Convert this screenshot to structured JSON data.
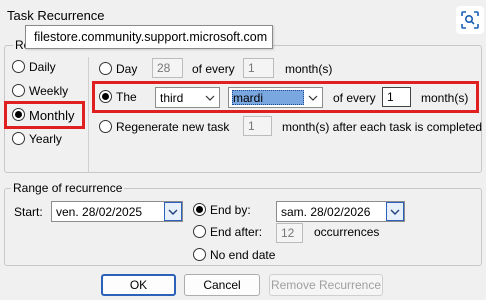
{
  "window": {
    "title": "Task Recurrence"
  },
  "tooltip": {
    "text": "filestore.community.support.microsoft.com"
  },
  "icons": {
    "scan": "scan-text-icon",
    "dropdown": "chevron-down-icon"
  },
  "accent": {
    "highlight_red": "#e02020",
    "focus_blue": "#2b61b8"
  },
  "pattern": {
    "legend": "Rec",
    "frequency": [
      {
        "label": "Daily",
        "checked": false
      },
      {
        "label": "Weekly",
        "checked": false
      },
      {
        "label": "Monthly",
        "checked": true
      },
      {
        "label": "Yearly",
        "checked": false
      }
    ],
    "day_option": {
      "label": "Day",
      "day_value": "28",
      "every_label": "of every",
      "months_value": "1",
      "months_unit": "month(s)"
    },
    "the_option": {
      "label": "The",
      "ordinal": "third",
      "weekday": "mardi",
      "every_label": "of every",
      "months_value": "1",
      "months_unit": "month(s)"
    },
    "regen_option": {
      "label": "Regenerate new task",
      "value": "1",
      "suffix": "month(s) after each task is completed"
    }
  },
  "range": {
    "legend": "Range of recurrence",
    "start_label": "Start:",
    "start_value": "ven. 28/02/2025",
    "end_by_label": "End by:",
    "end_by_value": "sam. 28/02/2026",
    "end_after_label": "End after:",
    "end_after_value": "12",
    "occurrences_label": "occurrences",
    "no_end_label": "No end date"
  },
  "buttons": {
    "ok": "OK",
    "cancel": "Cancel",
    "remove": "Remove Recurrence"
  }
}
